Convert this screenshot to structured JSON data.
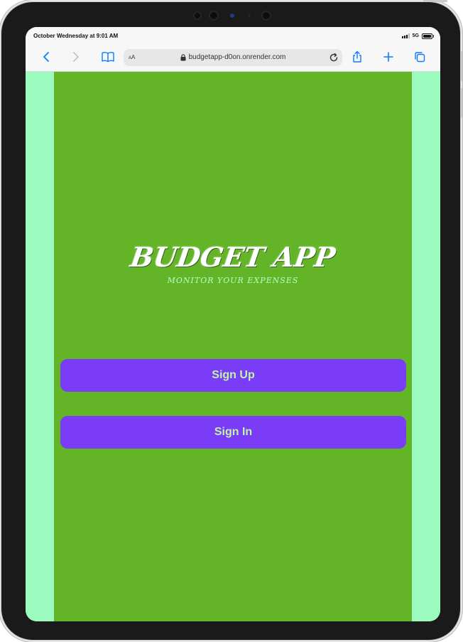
{
  "status_bar": {
    "time": "October Wednesday at 9:01 AM",
    "network": "5G"
  },
  "browser": {
    "address_prefix": "A",
    "address_prefix_big": "A",
    "url": "budgetapp-d0on.onrender.com",
    "icons": {
      "back": "chevron-left-icon",
      "forward": "chevron-right-icon",
      "bookmarks": "book-icon",
      "lock": "lock-icon",
      "reload": "reload-icon",
      "share": "share-icon",
      "new_tab": "plus-icon",
      "tabs": "tabs-icon"
    }
  },
  "app": {
    "title": "BUDGET APP",
    "tagline": "MONITOR YOUR EXPENSES",
    "buttons": {
      "sign_up": "Sign Up",
      "sign_in": "Sign In"
    }
  },
  "colors": {
    "accent_button": "#7a3cf7",
    "button_text": "#bff5a3",
    "page_main": "#63b426",
    "page_side": "#9bfbbf",
    "browser_blue": "#0a7aff"
  }
}
